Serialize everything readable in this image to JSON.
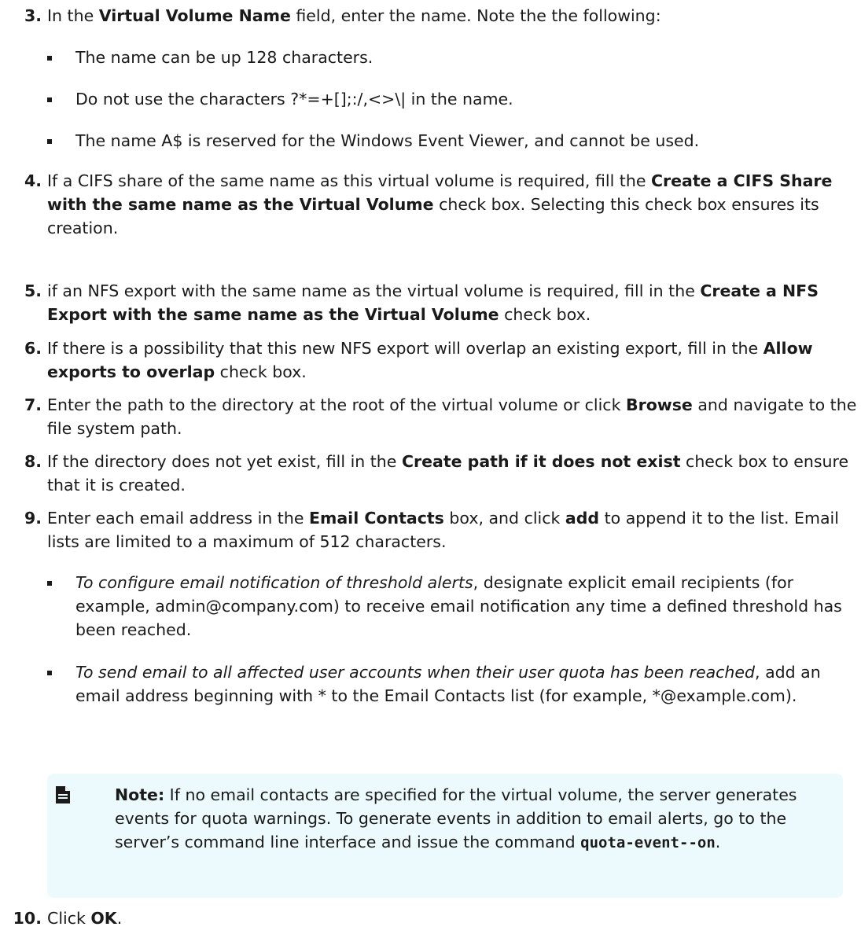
{
  "steps": {
    "s3": {
      "num": "3.",
      "t1": "In the ",
      "b1": "Virtual Volume Name",
      "t2": " field, enter the name. Note the the following:"
    },
    "s3_bullets": {
      "b1": "The name can be up 128 characters.",
      "b2": "Do not use the characters ?*=+[];:/,<>\\| in the name.",
      "b3": "The name A$ is reserved for the Windows Event Viewer, and cannot be used."
    },
    "s4": {
      "num": "4.",
      "t1": "If a CIFS share of the same name as this virtual volume is required, fill the ",
      "b1": "Create a CIFS Share with the same name as the Virtual Volume",
      "t2": " check box. Selecting this check box ensures its creation."
    },
    "s5": {
      "num": "5.",
      "t1": "if an NFS export with the same name as the virtual volume is required, fill in the ",
      "b1": "Create a NFS Export with the same name as the Virtual Volume",
      "t2": " check box."
    },
    "s6": {
      "num": "6.",
      "t1": "If there is a possibility that this new NFS export will overlap an existing export, fill in the ",
      "b1": "Allow exports to overlap",
      "t2": " check box."
    },
    "s7": {
      "num": "7.",
      "t1": "Enter the path to the directory at the root of the virtual volume or click ",
      "b1": "Browse",
      "t2": " and navigate to the file system path."
    },
    "s8": {
      "num": "8.",
      "t1": "If the directory does not yet exist, fill in the ",
      "b1": "Create path if it does not exist",
      "t2": " check box to ensure that it is created."
    },
    "s9": {
      "num": "9.",
      "t1": "Enter each email address in the ",
      "b1": "Email Contacts",
      "t2": " box, and click ",
      "b2": "add",
      "t3": " to append it to the list. Email lists are limited to a maximum of 512 characters."
    },
    "s9_bullets": {
      "b1_italic": "To configure email notification of threshold alerts",
      "b1_text": ", designate explicit email recipients (for example, admin@company.com) to receive email notification any time a defined threshold has been reached.",
      "b2_italic": "To send email to all affected user accounts when their user quota has been reached",
      "b2_text": ", add an email address beginning with * to the Email Contacts list (for example, *@example.com)."
    },
    "s10": {
      "num": "10.",
      "t1": "Click ",
      "b1": "OK",
      "t2": "."
    }
  },
  "note": {
    "icon": "document-note-icon",
    "label": "Note:",
    "text": " If no email contacts are specified for the virtual volume, the server generates events for quota warnings. To generate events in addition to email alerts, go to the server’s command line interface and issue the command ",
    "command": "quota-event--on",
    "end": "."
  }
}
